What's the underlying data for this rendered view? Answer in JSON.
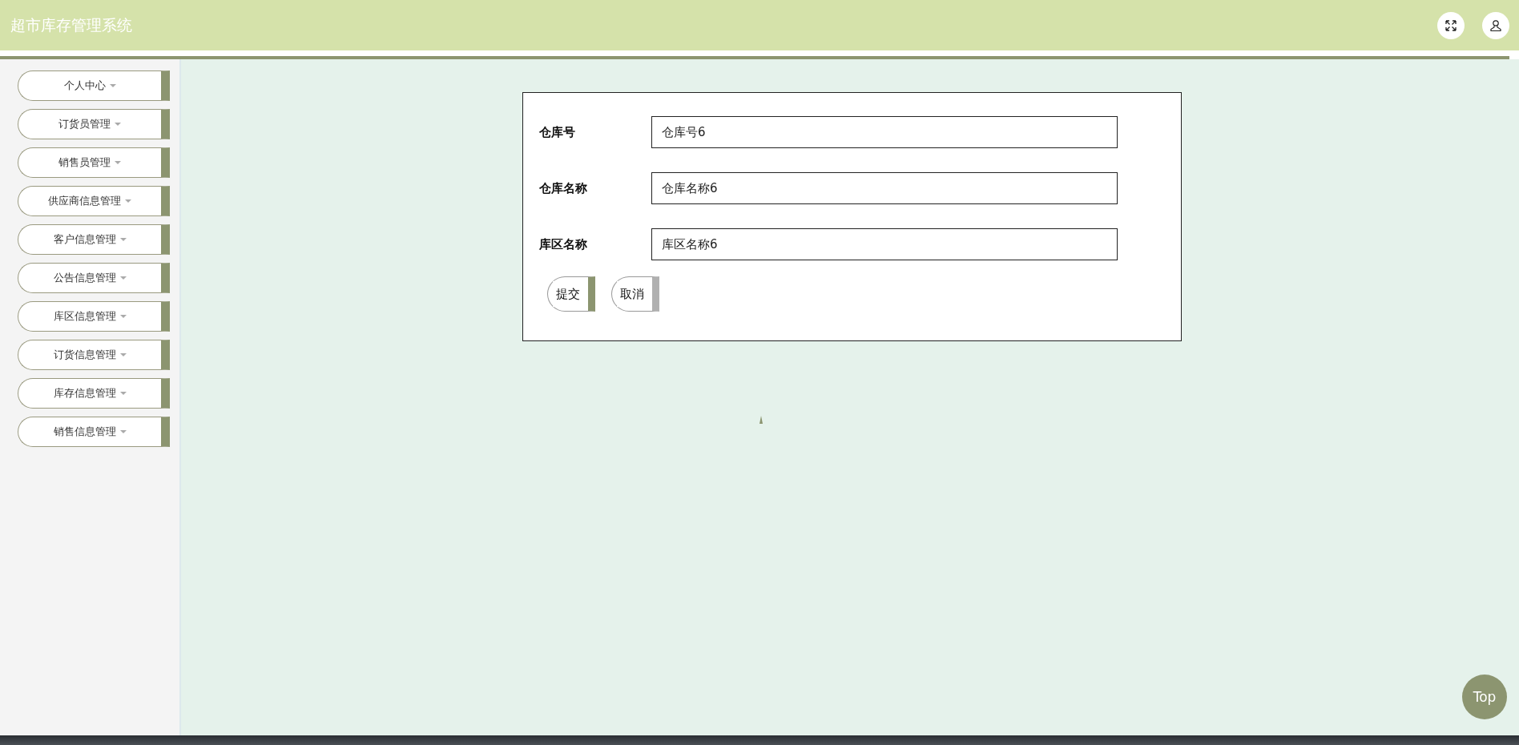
{
  "header": {
    "title": "超市库存管理系统"
  },
  "sidebar": {
    "items": [
      {
        "label": "个人中心"
      },
      {
        "label": "订货员管理"
      },
      {
        "label": "销售员管理"
      },
      {
        "label": "供应商信息管理"
      },
      {
        "label": "客户信息管理"
      },
      {
        "label": "公告信息管理"
      },
      {
        "label": "库区信息管理"
      },
      {
        "label": "订货信息管理"
      },
      {
        "label": "库存信息管理"
      },
      {
        "label": "销售信息管理"
      }
    ]
  },
  "form": {
    "fields": [
      {
        "label": "仓库号",
        "value": "仓库号6"
      },
      {
        "label": "仓库名称",
        "value": "仓库名称6"
      },
      {
        "label": "库区名称",
        "value": "库区名称6"
      }
    ],
    "buttons": [
      {
        "label": "提交",
        "kind": "primary"
      },
      {
        "label": "取消",
        "kind": "secondary"
      }
    ]
  },
  "back_to_top": {
    "label": "Top"
  }
}
